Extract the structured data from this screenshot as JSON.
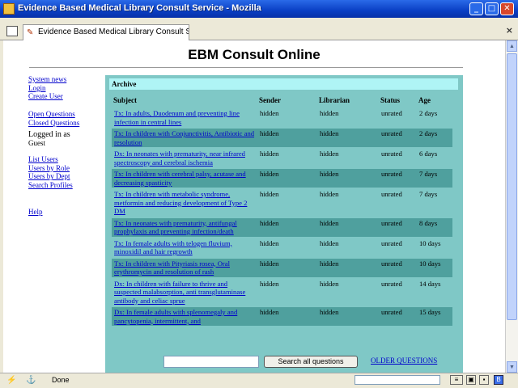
{
  "window": {
    "title": "Evidence Based Medical Library Consult Service - Mozilla",
    "tab_label": "Evidence Based Medical Library Consult Ser...",
    "close_glyph": "×"
  },
  "page": {
    "heading": "EBM Consult Online"
  },
  "sidebar": {
    "group1": [
      "System news",
      "Login",
      "Create User"
    ],
    "group2": [
      "Open Questions",
      "Closed Questions"
    ],
    "logged_in_label": "Logged in as",
    "logged_in_user": "Guest",
    "group3": [
      "List Users",
      "Users by Role",
      "Users by Dept",
      "Search Profiles"
    ],
    "help": "Help"
  },
  "archive": {
    "title": "Archive",
    "columns": [
      "Subject",
      "Sender",
      "Librarian",
      "Status",
      "Age"
    ],
    "rows": [
      {
        "subject": "Tx: In adults, Duodenum and preventing line infection in central lines",
        "sender": "hidden",
        "librarian": "hidden",
        "status": "unrated",
        "age": "2 days"
      },
      {
        "subject": "Tx: In children with Conjunctivitis, Antibiotic and resolution",
        "sender": "hidden",
        "librarian": "hidden",
        "status": "unrated",
        "age": "2 days"
      },
      {
        "subject": "Dx: In neonates with prematurity, near infrared spectroscopy and cerebral ischemia",
        "sender": "hidden",
        "librarian": "hidden",
        "status": "unrated",
        "age": "6 days"
      },
      {
        "subject": "Tx: In children with cerebral palsy, acutase and decreasing spasticity",
        "sender": "hidden",
        "librarian": "hidden",
        "status": "unrated",
        "age": "7 days"
      },
      {
        "subject": "Tx: In children with metabolic syndrome, metformin and reducing development of Type 2 DM",
        "sender": "hidden",
        "librarian": "hidden",
        "status": "unrated",
        "age": "7 days"
      },
      {
        "subject": "Tx: In neonates with prematurity, antifungal prophylaxis and preventing infection/death",
        "sender": "hidden",
        "librarian": "hidden",
        "status": "unrated",
        "age": "8 days"
      },
      {
        "subject": "Tx: In female adults with telogen fluvium, minoxidil and hair regrowth",
        "sender": "hidden",
        "librarian": "hidden",
        "status": "unrated",
        "age": "10 days"
      },
      {
        "subject": "Tx: In children with Pityriasis rosea, Oral erythromycin and resolution of rash",
        "sender": "hidden",
        "librarian": "hidden",
        "status": "unrated",
        "age": "10 days"
      },
      {
        "subject": "Dx: In children with failure to thrive and suspected malabsorption, anti transglutaminase antibody and celiac sprue",
        "sender": "hidden",
        "librarian": "hidden",
        "status": "unrated",
        "age": "14 days"
      },
      {
        "subject": "Dx: In female adults with splenomegaly and pancytopenia, intermittent, and",
        "sender": "hidden",
        "librarian": "hidden",
        "status": "unrated",
        "age": "15 days"
      }
    ],
    "search_button": "Search all questions",
    "search_value": "",
    "older_link": "OLDER QUESTIONS"
  },
  "statusbar": {
    "text": "Done"
  },
  "colors": {
    "panel": "#7fc8c6",
    "panel_header": "#aff4f5",
    "row_dark": "#4fa09e",
    "link": "#0000cc"
  }
}
